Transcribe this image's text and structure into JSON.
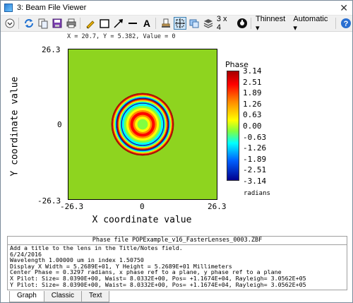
{
  "window": {
    "title": "3: Beam File Viewer",
    "close_glyph": "✕"
  },
  "toolbar": {
    "icons": [
      "dropdown-menu-icon",
      "refresh-icon",
      "copy-icon",
      "save-icon",
      "print-icon",
      "pencil-icon",
      "rectangle-icon",
      "arrow-icon",
      "line-icon",
      "text-icon",
      "stamp-icon",
      "crosshair-icon",
      "overlay-icon",
      "layers-icon",
      "settings-icon",
      "help-icon"
    ],
    "layout_label": "3 x 4",
    "thinnest_label": "Thinnest",
    "automatic_label": "Automatic",
    "text_tool_glyph": "A",
    "dropdown_arrow": "▾"
  },
  "readout": {
    "text": "X = 20.7, Y = 5.382, Value = 0"
  },
  "chart_data": {
    "type": "heatmap",
    "xlabel": "X coordinate value",
    "ylabel": "Y coordinate value",
    "xlim": [
      -26.3,
      26.3
    ],
    "ylim": [
      -26.3,
      26.3
    ],
    "x_ticks": [
      "-26.3",
      "0",
      "26.3"
    ],
    "y_ticks": [
      "26.3",
      "0",
      "-26.3"
    ],
    "background_value": 0,
    "colorbar": {
      "title": "Phase",
      "unit": "radians",
      "min": -3.14,
      "max": 3.14,
      "ticks": [
        "3.14",
        "2.51",
        "1.89",
        "1.26",
        "0.63",
        "0.00",
        "-0.63",
        "-1.26",
        "-1.89",
        "-2.51",
        "-3.14"
      ]
    },
    "rings": {
      "center": [
        0,
        0
      ],
      "aperture_radius": 11.0,
      "center_value": 0.3297
    }
  },
  "text_panel": {
    "header": "Phase file POPExample_v16_FasterLenses_0003.ZBF",
    "lines": [
      "Add a title to the lens in the Title/Notes field.",
      "6/24/2016",
      "Wavelength 1.00000 um in index 1.50750",
      "Display X Width = 5.2689E+01, Y Height = 5.2689E+01 Millimeters",
      "Center Phase = 0.3297 radians, x phase ref to a plane, y phase ref to a plane",
      "X Pilot: Size= 8.0390E+00, Waist= 8.0332E+00, Pos= +1.1674E+04, Rayleigh= 3.0562E+05",
      "Y Pilot: Size= 8.0390E+00, Waist= 8.0332E+00, Pos= +1.1674E+04, Rayleigh= 3.0562E+05"
    ]
  },
  "tabs": [
    {
      "label": "Graph",
      "active": true
    },
    {
      "label": "Classic",
      "active": false
    },
    {
      "label": "Text",
      "active": false
    }
  ]
}
